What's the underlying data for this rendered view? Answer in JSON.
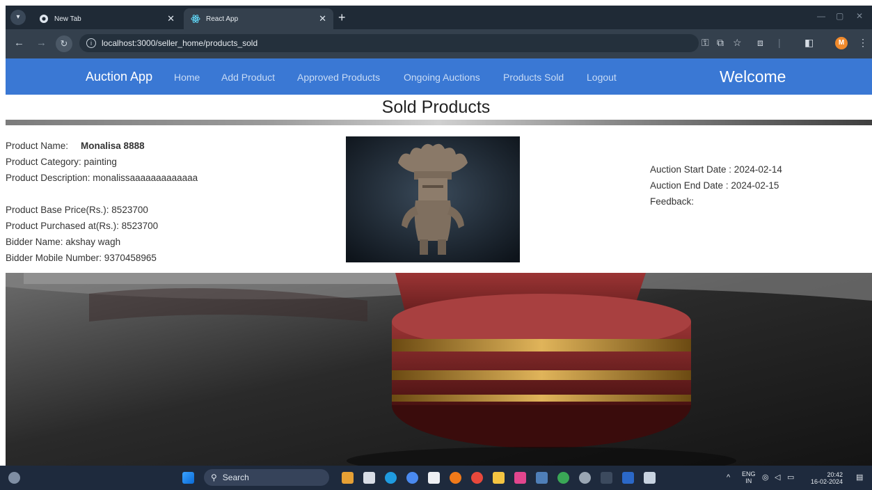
{
  "browser": {
    "tabs": [
      {
        "title": "New Tab"
      },
      {
        "title": "React App"
      }
    ],
    "url": "localhost:3000/seller_home/products_sold"
  },
  "navbar": {
    "brand": "Auction App",
    "links": [
      "Home",
      "Add Product",
      "Approved Products",
      "Ongoing Auctions",
      "Products Sold",
      "Logout"
    ],
    "welcome": "Welcome"
  },
  "page": {
    "title": "Sold Products"
  },
  "product": {
    "name_label": "Product Name:",
    "name": "Monalisa 8888",
    "category": "Product Category: painting",
    "description": "Product Description: monalissaaaaaaaaaaaaa",
    "base_price": "Product Base Price(Rs.): 8523700",
    "purchased_at": "Product Purchased at(Rs.): 8523700",
    "bidder_name": "Bidder Name: akshay wagh",
    "bidder_mobile": "Bidder Mobile Number: 9370458965",
    "auction_start": "Auction Start Date : 2024-02-14",
    "auction_end": "Auction End Date : 2024-02-15",
    "feedback": "Feedback:"
  },
  "taskbar": {
    "search_placeholder": "Search",
    "lang_top": "ENG",
    "lang_bottom": "IN",
    "time": "20:42",
    "date": "16-02-2024"
  },
  "colors": {
    "navbar": "#3a78d4",
    "tabbar": "#1f2a36",
    "taskbar": "#1e2a3d"
  }
}
